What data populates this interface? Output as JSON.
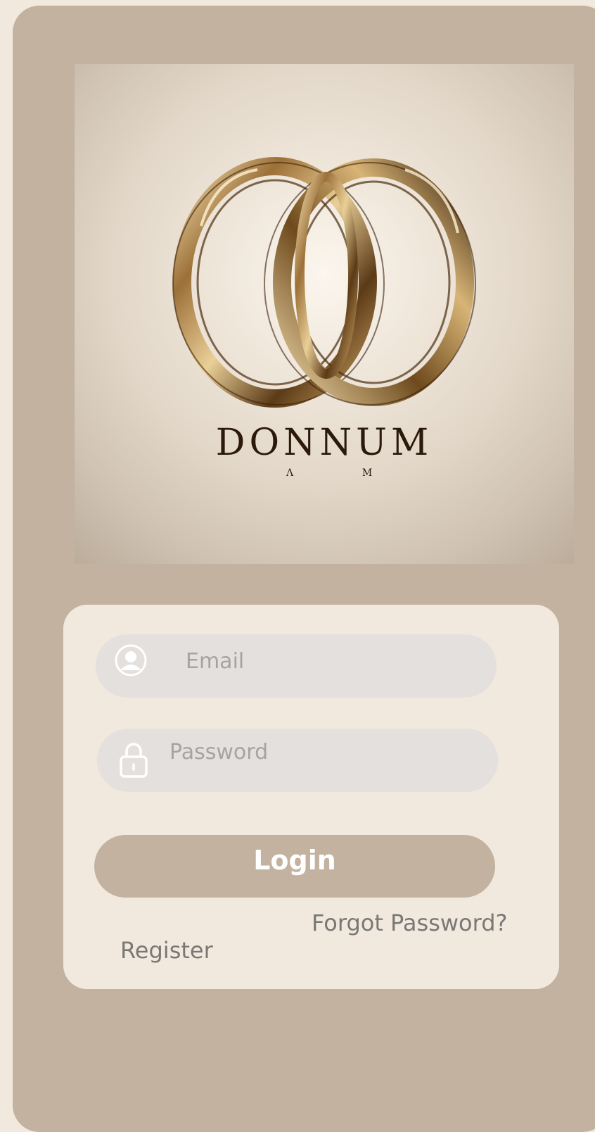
{
  "brand": {
    "logo_wordmark": "DONNUM"
  },
  "form": {
    "email_placeholder": "Email",
    "password_placeholder": "Password",
    "login_label": "Login",
    "forgot_password_label": "Forgot Password?",
    "register_label": "Register"
  },
  "icons": {
    "email": "user-icon",
    "password": "lock-icon"
  },
  "colors": {
    "page_background": "#f1e9de",
    "card_background": "#c2b29f",
    "input_background": "#e4e0de",
    "button_background": "#c2b29f",
    "link_text": "#7a7775"
  }
}
